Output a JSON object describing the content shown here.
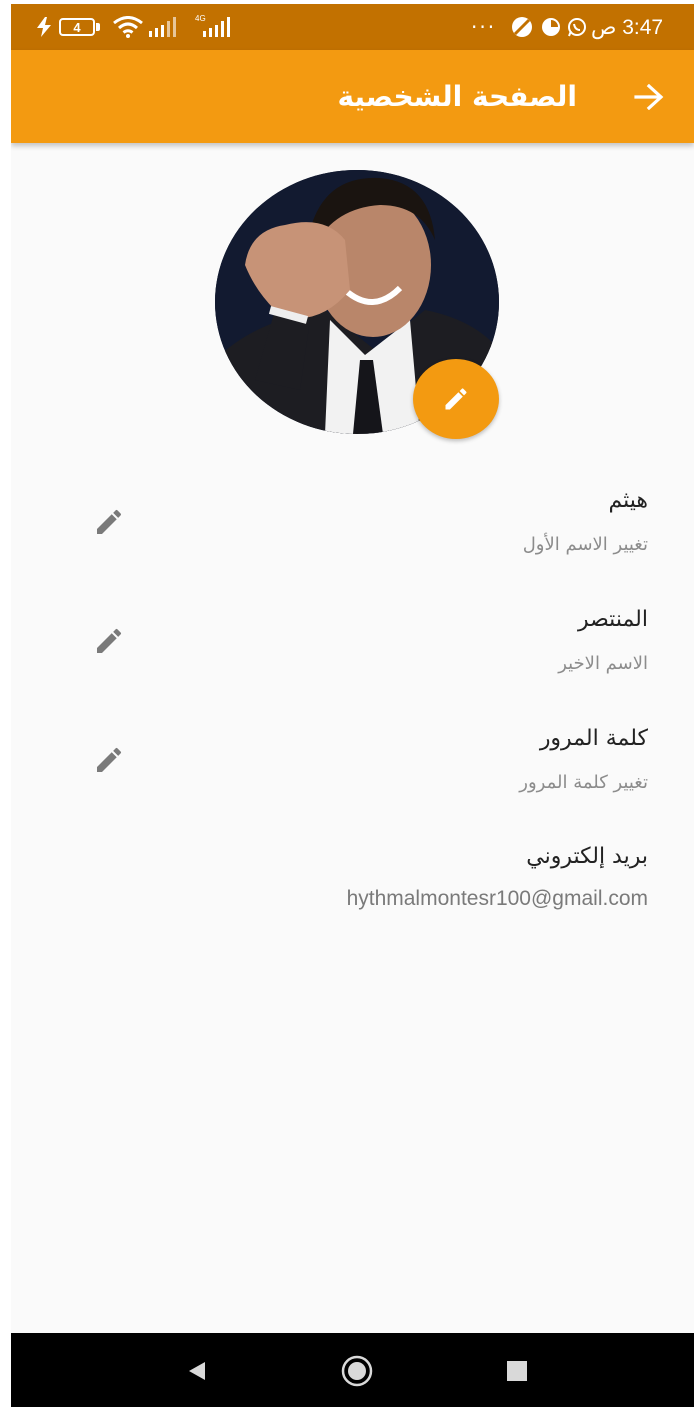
{
  "status_bar": {
    "time": "3:47 ص",
    "battery_level": "4",
    "network_type": "4G",
    "overflow_dots": "···",
    "icons": [
      "charging-icon",
      "battery-icon",
      "wifi-icon",
      "signal-icon",
      "signal-4g-icon",
      "dnd-icon",
      "data-saver-icon",
      "whatsapp-icon"
    ]
  },
  "app_bar": {
    "title": "الصفحة الشخصية",
    "back_icon": "arrow-right-icon",
    "background": "#f39a11"
  },
  "avatar": {
    "edit_icon": "pencil-icon",
    "accent": "#f39a11"
  },
  "fields": [
    {
      "title": "هيثم",
      "subtitle": "تغيير الاسم الأول",
      "editable": true
    },
    {
      "title": "المنتصر",
      "subtitle": "الاسم الاخير",
      "editable": true
    },
    {
      "title": "كلمة المرور",
      "subtitle": "تغيير كلمة المرور",
      "editable": true
    },
    {
      "title": "بريد إلكتروني",
      "subtitle": "hythmalmontesr100@gmail.com",
      "editable": false
    }
  ],
  "nav_bar": {
    "items": [
      "back-triangle-icon",
      "home-circle-icon",
      "recents-square-icon"
    ]
  },
  "colors": {
    "primary": "#f39a11",
    "status_bar": "#c27100",
    "background": "#fafafa",
    "icon_gray": "#7a7a7a"
  }
}
